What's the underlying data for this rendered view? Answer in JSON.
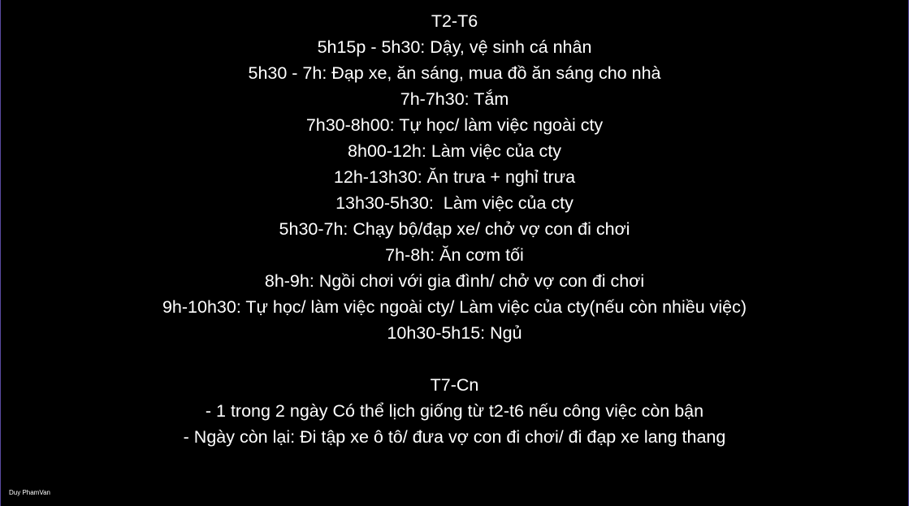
{
  "weekday_section": {
    "heading": "T2-T6",
    "items": [
      "5h15p - 5h30: Dậy, vệ sinh cá nhân",
      "5h30 - 7h: Đạp xe, ăn sáng, mua đồ ăn sáng cho nhà",
      "7h-7h30: Tắm",
      "7h30-8h00: Tự học/ làm việc ngoài cty",
      "8h00-12h: Làm việc của cty",
      "12h-13h30: Ăn trưa + nghỉ trưa",
      "13h30-5h30:  Làm việc của cty",
      "5h30-7h: Chạy bộ/đạp xe/ chở vợ con đi chơi",
      "7h-8h: Ăn cơm tối",
      "8h-9h: Ngồi chơi với gia đình/ chở vợ con đi chơi",
      "9h-10h30: Tự học/ làm việc ngoài cty/ Làm việc của cty(nếu còn nhiều việc)",
      "10h30-5h15: Ngủ"
    ]
  },
  "weekend_section": {
    "heading": "T7-Cn",
    "items": [
      "- 1 trong 2 ngày Có thể lịch giống từ t2-t6 nếu công việc còn bận",
      "- Ngày còn lại: Đi tập xe ô tô/ đưa vợ con đi chơi/ đi đạp xe lang thang"
    ]
  },
  "author_label": "Duy PhamVan",
  "colors": {
    "background": "#000000",
    "text": "#ffffff",
    "border": "#5a4aa0"
  }
}
